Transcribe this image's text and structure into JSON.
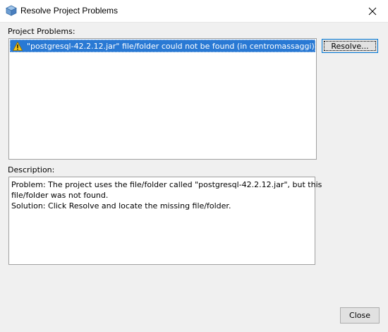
{
  "window": {
    "title": "Resolve Project Problems",
    "icon": "project-cube-icon",
    "close_icon": "close-icon"
  },
  "problems": {
    "label": "Project Problems:",
    "items": [
      {
        "icon": "warning-icon",
        "text": "\"postgresql-42.2.12.jar\" file/folder could not be found (in centromassaggi)",
        "selected": true
      }
    ],
    "resolve_label": "Resolve..."
  },
  "description": {
    "label": "Description:",
    "lines": [
      "Problem: The project uses the file/folder called \"postgresql-42.2.12.jar\", but this",
      "file/folder was not found.",
      "Solution: Click Resolve and locate the missing file/folder."
    ]
  },
  "footer": {
    "close_label": "Close"
  },
  "colors": {
    "selection": "#2979d4",
    "dialog_bg": "#f0f0f0",
    "focus_border": "#0078d7",
    "warning": "#f5c518"
  }
}
